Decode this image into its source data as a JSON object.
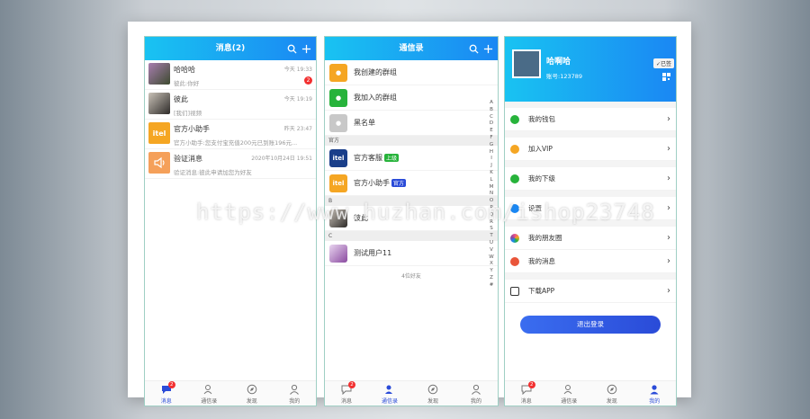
{
  "messages_screen": {
    "title": "消息(2)",
    "items": [
      {
        "name": "哈哈哈",
        "text": "彼此:你好",
        "time": "今天 19:33",
        "badge": "2"
      },
      {
        "name": "彼此",
        "text": "[我们]视频",
        "time": "今天 19:19",
        "badge": ""
      },
      {
        "name": "官方小助手",
        "text": "官方小助手:您支付宝充值200元已到账196元...",
        "time": "昨天 23:47",
        "badge": ""
      },
      {
        "name": "验证消息",
        "text": "验证消息:彼此申请加您为好友",
        "time": "2020年10月24日 19:51",
        "badge": ""
      }
    ]
  },
  "contacts_screen": {
    "title": "通信录",
    "top_items": [
      "我创建的群组",
      "我加入的群组",
      "黑名单"
    ],
    "sections": [
      {
        "header": "官方",
        "items": [
          {
            "label": "官方客服",
            "tag": "上级",
            "tag_color": "#27b33b"
          },
          {
            "label": "官方小助手",
            "tag": "官方",
            "tag_color": "#2a4bd8"
          }
        ]
      },
      {
        "header": "B",
        "items": [
          {
            "label": "彼此",
            "tag": "",
            "tag_color": ""
          }
        ]
      },
      {
        "header": "C",
        "items": [
          {
            "label": "测试用户11",
            "tag": "",
            "tag_color": ""
          }
        ]
      }
    ],
    "friend_count": "4位好友",
    "alphabet": "A B C D E F G H I J K L M N O P Q R S T U V W X Y Z #"
  },
  "profile_screen": {
    "name": "哈啊哈",
    "account": "账号:123789",
    "verified": "✓已签",
    "menu": [
      {
        "label": "我的钱包",
        "color": "#27b33b"
      },
      {
        "label": "加入VIP",
        "color": "#f5a623"
      },
      {
        "label": "我的下级",
        "color": "#27b33b"
      },
      {
        "label": "设置",
        "color": "#1a87f3"
      },
      {
        "label": "我的朋友圈",
        "color": "#e94f8b"
      },
      {
        "label": "我的消息",
        "color": "#e9553a"
      },
      {
        "label": "下载APP",
        "color": "#333333"
      }
    ],
    "logout": "退出登录"
  },
  "tabbar": {
    "tabs": [
      "消息",
      "通信录",
      "发现",
      "我的"
    ],
    "badge": "2"
  },
  "watermark": "https://www.huzhan.com/ishop23748",
  "colors": {
    "header_start": "#19c3f2",
    "header_end": "#1a87f3",
    "accent": "#2a4bd8",
    "badge": "#f23030"
  }
}
